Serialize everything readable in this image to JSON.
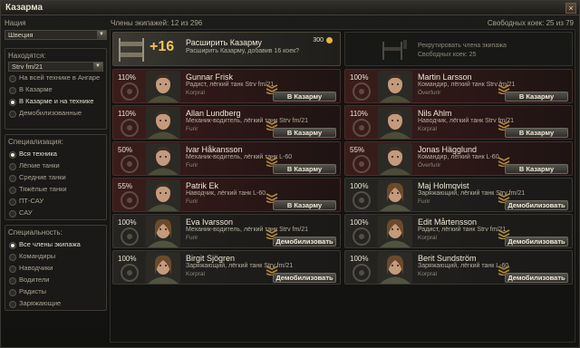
{
  "window": {
    "title": "Казарма",
    "close": "×"
  },
  "sidebar": {
    "nation_label": "Нация",
    "nation_value": "Швеция",
    "location_label": "Находятся:",
    "vehicle_value": "Strv fm/21",
    "location_options": [
      "На всей технике в Ангаре",
      "В Казарме",
      "В Казарме и на технике",
      "Демобилизованные"
    ],
    "location_selected": 2,
    "spec_label": "Специализация:",
    "spec_options": [
      "Вся техника",
      "Лёгкие танки",
      "Средние танки",
      "Тяжёлые танки",
      "ПТ-САУ",
      "САУ"
    ],
    "spec_selected": 0,
    "role_label": "Специальность:",
    "role_options": [
      "Все члены экипажа",
      "Командиры",
      "Наводчики",
      "Водители",
      "Радисты",
      "Заряжающие"
    ],
    "role_selected": 0
  },
  "header": {
    "members": "Члены экипажей: 12 из 296",
    "free_beds": "Свободных коек: 25 из 79"
  },
  "promo": {
    "plus": "+16",
    "title": "Расширить Казарму",
    "subtitle": "Расширить Казарму, добавив 16 коек?",
    "cost": "300"
  },
  "recruit": {
    "title": "Рекрутировать члена экипажа",
    "beds": "Свободных коек: 25"
  },
  "crew": [
    {
      "pct": "110%",
      "name": "Gunnar Frisk",
      "role": "Радист, лёгкий танк Strv fm/21",
      "rank": "Korpral",
      "button": "В Казарму",
      "state": "tank",
      "face": "m"
    },
    {
      "pct": "100%",
      "name": "Martin Larsson",
      "role": "Командир, лёгкий танк Strv fm/21",
      "rank": "Överfurir",
      "button": "В Казарму",
      "state": "tank",
      "face": "m"
    },
    {
      "pct": "110%",
      "name": "Allan Lundberg",
      "role": "Механик-водитель, лёгкий танк Strv fm/21",
      "rank": "Furir",
      "button": "В Казарму",
      "state": "tank",
      "face": "m"
    },
    {
      "pct": "110%",
      "name": "Nils Ahlm",
      "role": "Наводчик, лёгкий танк Strv fm/21",
      "rank": "Korpral",
      "button": "В Казарму",
      "state": "tank",
      "face": "m"
    },
    {
      "pct": "50%",
      "name": "Ivar Håkansson",
      "role": "Механик-водитель, лёгкий танк L-60",
      "rank": "Furir",
      "button": "В Казарму",
      "state": "tank",
      "face": "m"
    },
    {
      "pct": "55%",
      "name": "Jonas Hägglund",
      "role": "Командир, лёгкий танк L-60",
      "rank": "Överfurir",
      "button": "В Казарму",
      "state": "tank",
      "face": "m"
    },
    {
      "pct": "55%",
      "name": "Patrik Ek",
      "role": "Наводчик, лёгкий танк L-60",
      "rank": "Furir",
      "button": "В Казарму",
      "state": "tank",
      "face": "m"
    },
    {
      "pct": "100%",
      "name": "Maj Holmqvist",
      "role": "Заряжающий, лёгкий танк Strv fm/21",
      "rank": "Furir",
      "button": "Демобилизовать",
      "state": "barracks",
      "face": "f"
    },
    {
      "pct": "100%",
      "name": "Eva Ivarsson",
      "role": "Механик-водитель, лёгкий танк Strv fm/21",
      "rank": "Furir",
      "button": "Демобилизовать",
      "state": "barracks",
      "face": "f"
    },
    {
      "pct": "100%",
      "name": "Edit Mårtensson",
      "role": "Радист, лёгкий танк Strv fm/21",
      "rank": "Korpral",
      "button": "Демобилизовать",
      "state": "barracks",
      "face": "f"
    },
    {
      "pct": "100%",
      "name": "Birgit Sjögren",
      "role": "Заряжающий, лёгкий танк Strv fm/21",
      "rank": "Korpral",
      "button": "Демобилизовать",
      "state": "barracks",
      "face": "f"
    },
    {
      "pct": "100%",
      "name": "Berit Sundström",
      "role": "Заряжающий, лёгкий танк L-60",
      "rank": "Korpral",
      "button": "Демобилизовать",
      "state": "barracks",
      "face": "f"
    }
  ],
  "colors": {
    "accent_gold": "#f1c453",
    "in_tank_card": "#3b1d1a",
    "barracks_card": "#262522"
  }
}
